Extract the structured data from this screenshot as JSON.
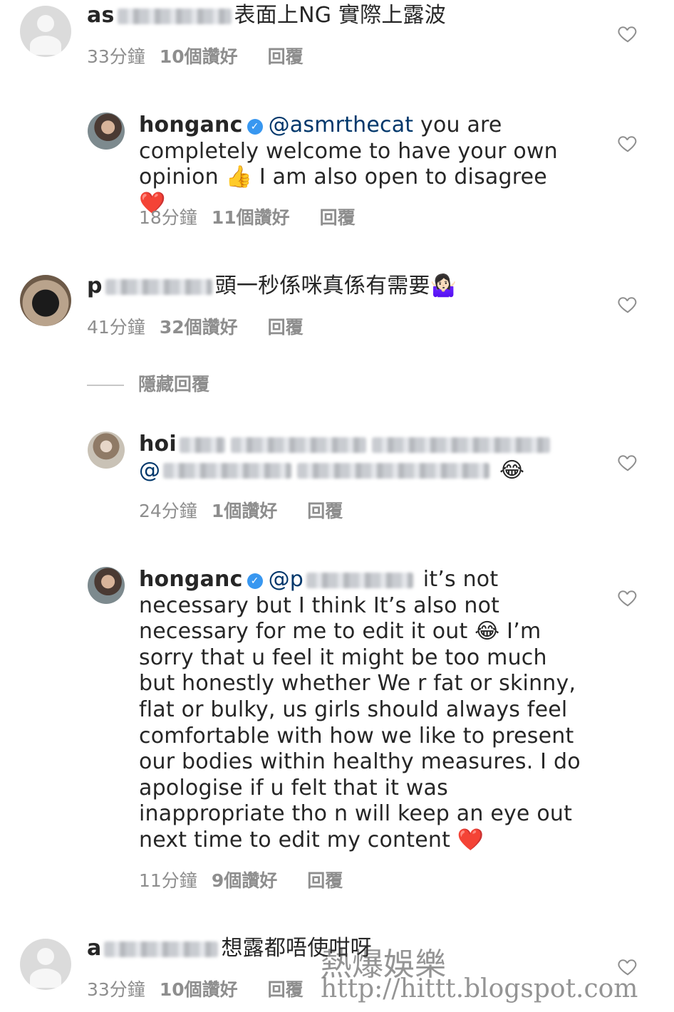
{
  "comments": [
    {
      "username_visible": "as",
      "text": "表面上NG 實際上露波",
      "time": "33分鐘",
      "likes": "10個讚好",
      "reply": "回覆"
    },
    {
      "username": "honganc",
      "mention": "@asmrthecat",
      "text": "you are completely welcome to have your own opinion 👍 I am also open to disagree ❤️",
      "time": "18分鐘",
      "likes": "11個讚好",
      "reply": "回覆"
    },
    {
      "username_visible": "p",
      "text": "頭一秒係咪真係有需要🤷🏻‍♀️",
      "time": "41分鐘",
      "likes": "32個讚好",
      "reply": "回覆"
    },
    {
      "username_visible": "hoi",
      "mention_visible": "@",
      "emoji": "😂",
      "time": "24分鐘",
      "likes": "1個讚好",
      "reply": "回覆"
    },
    {
      "username": "honganc",
      "mention_visible": "@p",
      "text_line1": "it’s not",
      "text": "necessary but I think It’s also not necessary for me to edit it out 😂 I’m sorry that u feel it might be too much but honestly whether We r fat or skinny, flat or bulky, us girls should always feel comfortable with how we like to present our bodies within healthy measures. I do apologise if u felt that it was inappropriate tho n will keep an eye out next time to edit my content ❤️",
      "time": "11分鐘",
      "likes": "9個讚好",
      "reply": "回覆"
    },
    {
      "username_visible": "a",
      "text": "想露都唔使咁呀",
      "time": "33分鐘",
      "likes": "10個讚好",
      "reply": "回覆"
    }
  ],
  "hide_replies": "隱藏回覆",
  "watermark": {
    "title": "熱爆娛樂",
    "url": "http://hittt.blogspot.com"
  },
  "icons": {
    "like": "heart-outline-icon",
    "verified": "verified-badge-icon",
    "avatar_default": "default-avatar-icon"
  },
  "colors": {
    "text": "#262626",
    "meta": "#8e8e8e",
    "mention": "#00376b",
    "verified": "#3897f0"
  }
}
